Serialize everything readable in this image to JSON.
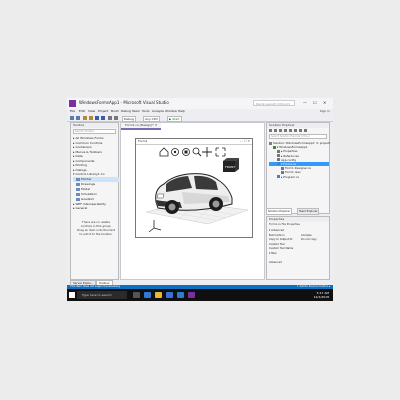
{
  "window": {
    "title": "WindowsFormsApp1 - Microsoft Visual Studio",
    "quick_launch": "Quick Launch (Ctrl+Q)",
    "controls": [
      "—",
      "☐",
      "✕"
    ],
    "sign_in": "Sign in"
  },
  "menu": [
    "File",
    "Edit",
    "View",
    "Project",
    "Build",
    "Debug",
    "Team",
    "Tools",
    "Analyze",
    "Window",
    "Help"
  ],
  "toolbar": {
    "config": "Debug",
    "platform": "Any CPU",
    "start": "▶ Start"
  },
  "toolbox": {
    "title": "Toolbox",
    "search_placeholder": "Search Toolbox",
    "items": [
      "▸ All Windows Forms",
      "▸ Common Controls",
      "▸ Containers",
      "▸ Menus & Toolbars",
      "▸ Data",
      "▸ Components",
      "▸ Printing",
      "▸ Dialogs",
      "▾ Control Library1 Co"
    ],
    "sub_items": [
      "Pointer",
      "Drawings",
      "Model",
      "Simulation",
      "Goedbid"
    ],
    "after_items": [
      "▸ WPF Interoperability",
      "▸ General"
    ],
    "note": "There are no usable controls in this group. Drag an item onto this text to add it to the toolbox.",
    "tabs": [
      "Server Explo...",
      "Toolbox"
    ]
  },
  "editor": {
    "doc_tab": "Form1.cs [Design]* ✕",
    "form_title": "Form1",
    "form_buttons": "— ☐ ✕",
    "viewer_tools": [
      "home-icon",
      "orbit-icon",
      "zoom-window-icon",
      "zoom-icon",
      "pan-icon",
      "zoom-extents-icon",
      "fit-icon"
    ],
    "viewcube_label": "FRONT"
  },
  "solution_explorer": {
    "title": "Solution Explorer",
    "search_placeholder": "Search Solution Explorer (Ctrl+;)",
    "tree": [
      {
        "label": "Solution 'WindowsFormsApp1' (1 project)",
        "indent": 0,
        "icon": "#7a7aa0",
        "selected": false
      },
      {
        "label": "▾ WindowsFormsApp1",
        "indent": 1,
        "icon": "#3a8a3a",
        "selected": false
      },
      {
        "label": "▸ Properties",
        "indent": 2,
        "icon": "#777777",
        "selected": false
      },
      {
        "label": "▸ References",
        "indent": 2,
        "icon": "#777777",
        "selected": false
      },
      {
        "label": "App.config",
        "indent": 2,
        "icon": "#777777",
        "selected": false
      },
      {
        "label": "▾ Form1.cs",
        "indent": 2,
        "icon": "#4a7fc0",
        "selected": true
      },
      {
        "label": "Form1.Designer.cs",
        "indent": 3,
        "icon": "#4a7fc0",
        "selected": false
      },
      {
        "label": "Form1.resx",
        "indent": 3,
        "icon": "#777777",
        "selected": false
      },
      {
        "label": "▸ Program.cs",
        "indent": 2,
        "icon": "#4a7fc0",
        "selected": false
      }
    ],
    "tabs": [
      "Solution Explorer",
      "Team Explorer"
    ]
  },
  "properties": {
    "title": "Properties",
    "subtitle": "Form1.cs File Properties",
    "rows": [
      {
        "name": "▾ Advanced",
        "value": ""
      },
      {
        "name": "Build Action",
        "value": "Compile"
      },
      {
        "name": "Copy to Output Di",
        "value": "Do not copy"
      },
      {
        "name": "Custom Tool",
        "value": ""
      },
      {
        "name": "Custom Tool Name",
        "value": ""
      },
      {
        "name": "▾ Misc",
        "value": ""
      },
      {
        "name": "",
        "value": ""
      },
      {
        "name": "Advanced",
        "value": ""
      }
    ]
  },
  "status_bar": {
    "text": "This item does not support previewing",
    "right": "↑ Add to Source Control ▴"
  },
  "taskbar": {
    "search": "Type here to search",
    "apps": [
      {
        "name": "task-view-icon",
        "color": "#555555"
      },
      {
        "name": "edge-icon",
        "color": "#2f7bd4"
      },
      {
        "name": "file-explorer-icon",
        "color": "#e6b53a"
      },
      {
        "name": "store-icon",
        "color": "#3a6fd4"
      },
      {
        "name": "mail-icon",
        "color": "#2f7bd4"
      },
      {
        "name": "visual-studio-icon",
        "color": "#7a2f9e"
      }
    ],
    "time": "5:17 AM",
    "date": "12/1/2018"
  },
  "colors": {
    "accent": "#7a2f9e",
    "status_bar": "#0e70c0",
    "selection": "#3399ff"
  }
}
